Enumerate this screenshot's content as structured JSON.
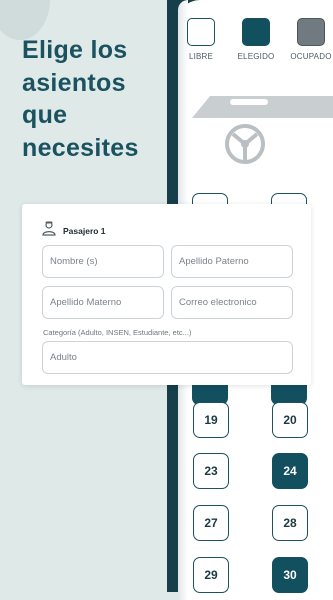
{
  "headline": "Elige los\nasientos\nque\nnecesites",
  "legend": [
    {
      "label": "LIBRE",
      "color": "#ffffff"
    },
    {
      "label": "ELEGIDO",
      "color": "#13505f"
    },
    {
      "label": "OCUPADO",
      "color": "#6f7b80"
    }
  ],
  "form": {
    "title": "Pasajero 1",
    "nombre_placeholder": "Nombre (s)",
    "apellido_paterno_placeholder": "Apellido Paterno",
    "apellido_materno_placeholder": "Apellido Materno",
    "correo_placeholder": "Correo electronico",
    "categoria_label": "Categoría (Adulto, INSEN, Estudiante, etc...)",
    "categoria_placeholder": "Adulto"
  },
  "seats": [
    {
      "number": "19",
      "state": "free"
    },
    {
      "number": "20",
      "state": "free"
    },
    {
      "number": "23",
      "state": "free"
    },
    {
      "number": "24",
      "state": "selected"
    },
    {
      "number": "27",
      "state": "free"
    },
    {
      "number": "28",
      "state": "free"
    },
    {
      "number": "29",
      "state": "free"
    },
    {
      "number": "30",
      "state": "selected"
    }
  ],
  "colors": {
    "primary": "#13505f",
    "dark_panel": "#173e4b",
    "background": "#dfe9e8"
  }
}
